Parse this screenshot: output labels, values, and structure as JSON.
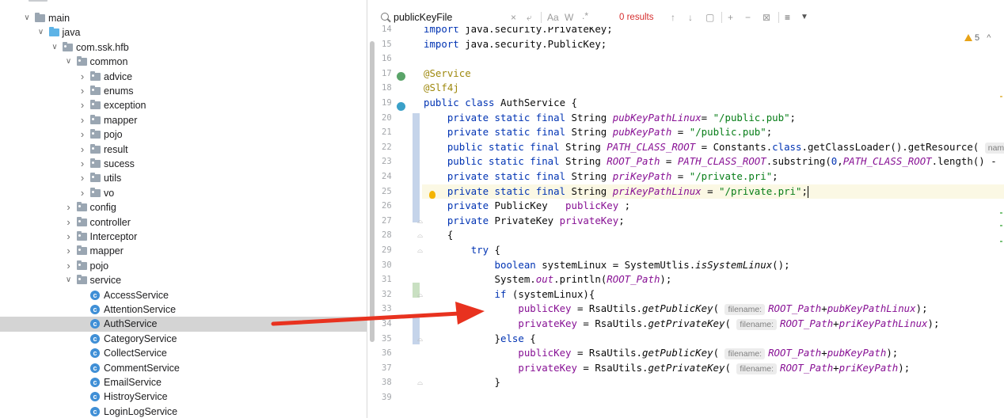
{
  "tree": {
    "items": [
      {
        "label": "main",
        "indent": 0,
        "kind": "folder",
        "expanded": true
      },
      {
        "label": "java",
        "indent": 1,
        "kind": "folder-blue",
        "expanded": true
      },
      {
        "label": "com.ssk.hfb",
        "indent": 2,
        "kind": "package",
        "expanded": true
      },
      {
        "label": "common",
        "indent": 3,
        "kind": "package",
        "expanded": true
      },
      {
        "label": "advice",
        "indent": 4,
        "kind": "package",
        "expanded": false
      },
      {
        "label": "enums",
        "indent": 4,
        "kind": "package",
        "expanded": false
      },
      {
        "label": "exception",
        "indent": 4,
        "kind": "package",
        "expanded": false
      },
      {
        "label": "mapper",
        "indent": 4,
        "kind": "package",
        "expanded": false
      },
      {
        "label": "pojo",
        "indent": 4,
        "kind": "package",
        "expanded": false
      },
      {
        "label": "result",
        "indent": 4,
        "kind": "package",
        "expanded": false
      },
      {
        "label": "sucess",
        "indent": 4,
        "kind": "package",
        "expanded": false
      },
      {
        "label": "utils",
        "indent": 4,
        "kind": "package",
        "expanded": false
      },
      {
        "label": "vo",
        "indent": 4,
        "kind": "package",
        "expanded": false
      },
      {
        "label": "config",
        "indent": 3,
        "kind": "package",
        "expanded": false
      },
      {
        "label": "controller",
        "indent": 3,
        "kind": "package",
        "expanded": false
      },
      {
        "label": "Interceptor",
        "indent": 3,
        "kind": "package",
        "expanded": false
      },
      {
        "label": "mapper",
        "indent": 3,
        "kind": "package",
        "expanded": false
      },
      {
        "label": "pojo",
        "indent": 3,
        "kind": "package",
        "expanded": false
      },
      {
        "label": "service",
        "indent": 3,
        "kind": "package",
        "expanded": true
      },
      {
        "label": "AccessService",
        "indent": 4,
        "kind": "class"
      },
      {
        "label": "AttentionService",
        "indent": 4,
        "kind": "class"
      },
      {
        "label": "AuthService",
        "indent": 4,
        "kind": "class",
        "selected": true
      },
      {
        "label": "CategoryService",
        "indent": 4,
        "kind": "class"
      },
      {
        "label": "CollectService",
        "indent": 4,
        "kind": "class"
      },
      {
        "label": "CommentService",
        "indent": 4,
        "kind": "class"
      },
      {
        "label": "EmailService",
        "indent": 4,
        "kind": "class"
      },
      {
        "label": "HistroyService",
        "indent": 4,
        "kind": "class"
      },
      {
        "label": "LoginLogService",
        "indent": 4,
        "kind": "class"
      }
    ]
  },
  "search": {
    "query": "publicKeyFile",
    "clear_icon": "×",
    "newline_icon": "⤶",
    "match_case": "Aa",
    "whole_word": "W",
    "regex": ".*",
    "results": "0 results",
    "prev_icon": "↑",
    "next_icon": "↓",
    "select_all_icon": "▢",
    "add_occurrence_icon": "+",
    "remove_occurrence_icon": "−",
    "select_all_occurrences_icon": "⊠",
    "multiline_icon": "≡",
    "filter_icon": "▼"
  },
  "editor": {
    "warnings_count": "5",
    "warnings_chevron": "^",
    "current_line": "25",
    "lines": [
      {
        "n": "14",
        "html": "<span class=\"kw\">import</span> java.security.PrivateKey;"
      },
      {
        "n": "15",
        "html": "<span class=\"kw\">import</span> java.security.PublicKey;"
      },
      {
        "n": "16",
        "html": ""
      },
      {
        "n": "17",
        "html": "<span class=\"ann\">@Service</span>"
      },
      {
        "n": "18",
        "html": "<span class=\"ann\">@Slf4j</span>"
      },
      {
        "n": "19",
        "html": "<span class=\"kw\">public class</span> AuthService {"
      },
      {
        "n": "20",
        "html": "    <span class=\"kw\">private static final</span> String <span class=\"fld\">pubKeyPathLinux</span>= <span class=\"str\">\"/public.pub\"</span>;"
      },
      {
        "n": "21",
        "html": "    <span class=\"kw\">private static final</span> String <span class=\"fld\">pubKeyPath</span> = <span class=\"str\">\"/public.pub\"</span>;"
      },
      {
        "n": "22",
        "html": "    <span class=\"kw\">public static final</span> String <span class=\"fld\">PATH_CLASS_ROOT</span> = Constants.<span class=\"kw\">class</span>.getClassLoader().getResource( <span class=\"hint\">name:</span>"
      },
      {
        "n": "23",
        "html": "    <span class=\"kw\">public static final</span> String <span class=\"fld\">ROOT_Path</span> = <span class=\"fld\">PATH_CLASS_ROOT</span>.substring(<span class=\"kw\">0</span>,<span class=\"fld\">PATH_CLASS_ROOT</span>.length() - <span class=\"str\">\"W</span>"
      },
      {
        "n": "24",
        "html": "    <span class=\"kw\">private static final</span> String <span class=\"fld\">priKeyPath</span> = <span class=\"str\">\"/private.pri\"</span>;"
      },
      {
        "n": "25",
        "html": "    <span class=\"kw\">private static final</span> String <span class=\"fld\">priKeyPathLinux</span> = <span class=\"str\">\"/private.pri\"</span>;<span class=\"caret\"></span>"
      },
      {
        "n": "26",
        "html": "    <span class=\"kw\">private</span> PublicKey   <span class=\"fld\" style=\"font-style:normal\">publicKey</span> ;"
      },
      {
        "n": "27",
        "html": "    <span class=\"kw\">private</span> PrivateKey <span class=\"fld\" style=\"font-style:normal\">privateKey</span>;"
      },
      {
        "n": "28",
        "html": "    {"
      },
      {
        "n": "29",
        "html": "        <span class=\"kw\">try</span> {"
      },
      {
        "n": "30",
        "html": "            <span class=\"kw\">boolean</span> systemLinux = SystemUtlis.<span class=\"mth\">isSystemLinux</span>();"
      },
      {
        "n": "31",
        "html": "            System.<span class=\"fld\">out</span>.println(<span class=\"fld\">ROOT_Path</span>);"
      },
      {
        "n": "32",
        "html": "            <span class=\"kw\">if</span> (systemLinux){"
      },
      {
        "n": "33",
        "html": "                <span class=\"fld\" style=\"font-style:normal\">publicKey</span> = RsaUtils.<span class=\"mth\">getPublicKey</span>( <span class=\"hint\">filename:</span><span class=\"fld\">ROOT_Path</span>+<span class=\"fld\">pubKeyPathLinux</span>);"
      },
      {
        "n": "34",
        "html": "                <span class=\"fld\" style=\"font-style:normal\">privateKey</span> = RsaUtils.<span class=\"mth\">getPrivateKey</span>( <span class=\"hint\">filename:</span><span class=\"fld\">ROOT_Path</span>+<span class=\"fld\">priKeyPathLinux</span>);"
      },
      {
        "n": "35",
        "html": "            }<span class=\"kw\">else</span> {"
      },
      {
        "n": "36",
        "html": "                <span class=\"fld\" style=\"font-style:normal\">publicKey</span> = RsaUtils.<span class=\"mth\">getPublicKey</span>( <span class=\"hint\">filename:</span><span class=\"fld\">ROOT_Path</span>+<span class=\"fld\">pubKeyPath</span>);"
      },
      {
        "n": "37",
        "html": "                <span class=\"fld\" style=\"font-style:normal\">privateKey</span> = RsaUtils.<span class=\"mth\">getPrivateKey</span>( <span class=\"hint\">filename:</span><span class=\"fld\">ROOT_Path</span>+<span class=\"fld\">priKeyPath</span>);"
      },
      {
        "n": "38",
        "html": "            }"
      },
      {
        "n": "39",
        "html": ""
      }
    ]
  },
  "colors": {
    "accent_blue": "#3f8fd6",
    "selection_gray": "#d4d4d4",
    "arrow_red": "#e8321f",
    "keyword_blue": "#0033b3",
    "string_green": "#067d17",
    "field_purple": "#871094",
    "annotation_olive": "#9e880d"
  }
}
